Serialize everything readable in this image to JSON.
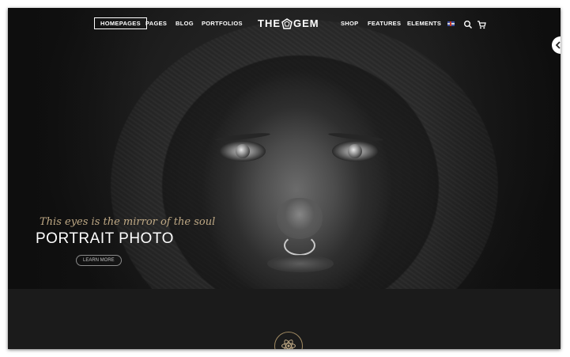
{
  "nav": {
    "left_items": [
      {
        "label": "HOMEPAGES",
        "active": true
      },
      {
        "label": "PAGES",
        "active": false
      },
      {
        "label": "BLOG",
        "active": false
      },
      {
        "label": "PORTFOLIOS",
        "active": false
      }
    ],
    "logo": {
      "left": "THE",
      "right": "GEM"
    },
    "right_items": [
      {
        "label": "SHOP"
      },
      {
        "label": "FEATURES"
      },
      {
        "label": "ELEMENTS"
      }
    ],
    "icons": [
      "uk-flag-icon",
      "search-icon",
      "cart-icon"
    ]
  },
  "slide": {
    "tagline": "This eyes is the mirror of the soul",
    "headline": "PORTRAIT PHOTO",
    "button_label": "LEARN MORE"
  },
  "colors": {
    "background": "#1b1b1b",
    "accent_gold": "#bfa985",
    "text": "#ffffff"
  }
}
